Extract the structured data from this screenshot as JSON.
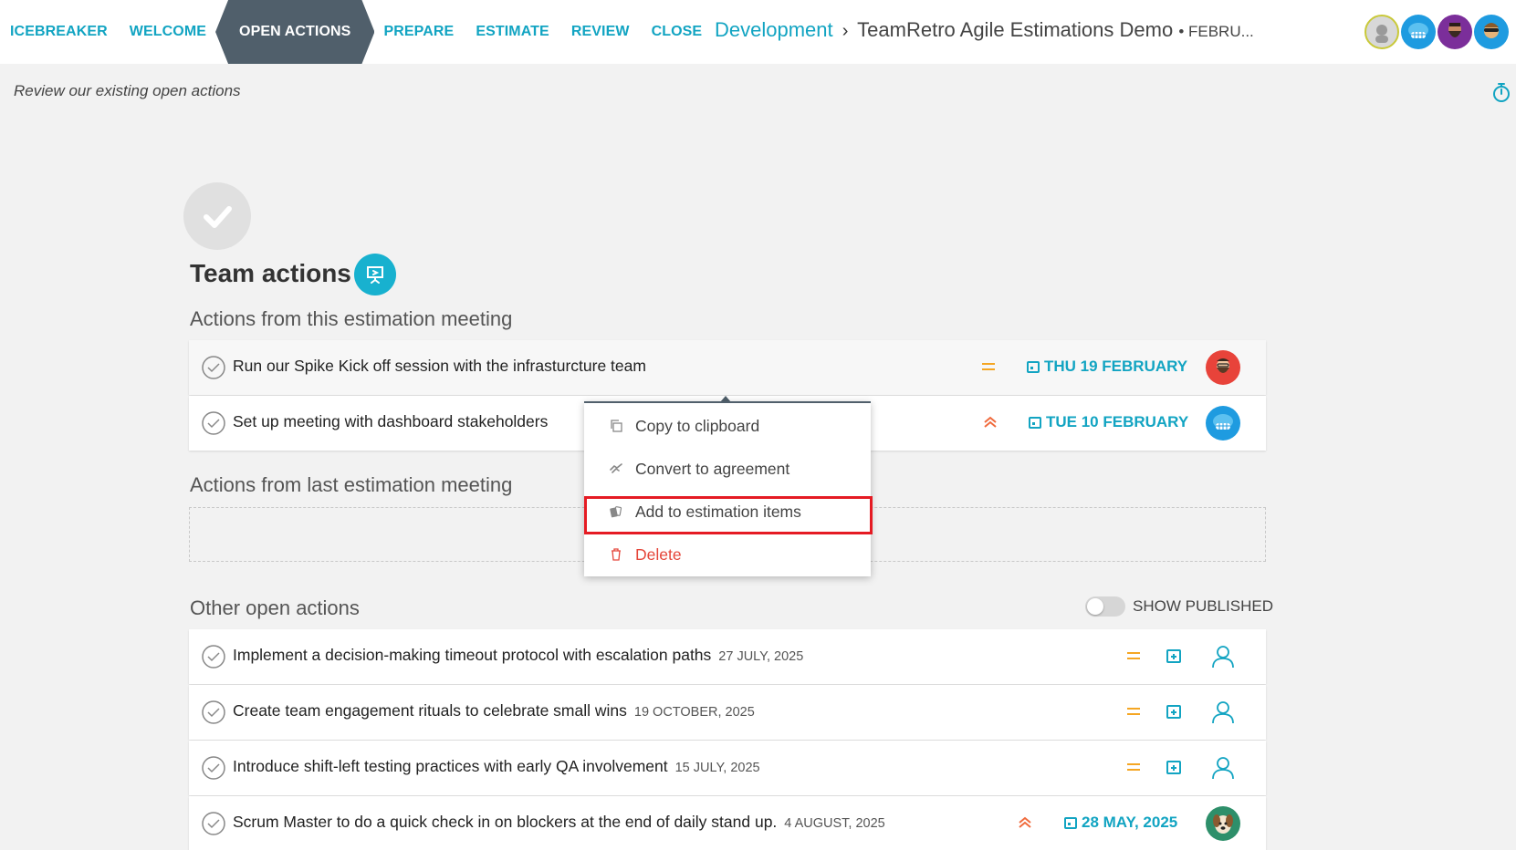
{
  "nav": {
    "items": [
      {
        "label": "ICEBREAKER"
      },
      {
        "label": "WELCOME"
      },
      {
        "label": "OPEN ACTIONS"
      },
      {
        "label": "PREPARE"
      },
      {
        "label": "ESTIMATE"
      },
      {
        "label": "REVIEW"
      },
      {
        "label": "CLOSE"
      }
    ],
    "active_index": 2
  },
  "breadcrumb": {
    "team": "Development",
    "separator": "›",
    "title": "TeamRetro Agile Estimations Demo",
    "date": "• FEBRU..."
  },
  "subtitle": "Review our existing open actions",
  "main": {
    "title": "Team actions",
    "sections": {
      "this_meeting": "Actions from this estimation meeting",
      "last_meeting": "Actions from last estimation meeting",
      "other": "Other open actions"
    },
    "this_meeting_actions": [
      {
        "text": "Run our Spike Kick off session with the infrasturcture team",
        "priority": "medium",
        "due": "THU 19 FEBRUARY"
      },
      {
        "text": "Set up meeting with dashboard stakeholders",
        "priority": "high",
        "due": "TUE 10 FEBRUARY"
      }
    ],
    "show_published_label": "SHOW PUBLISHED",
    "show_published": false,
    "other_actions": [
      {
        "text": "Implement a decision-making timeout protocol with escalation paths",
        "date": "27 JULY, 2025",
        "priority": "medium",
        "due": ""
      },
      {
        "text": "Create team engagement rituals to celebrate small wins",
        "date": "19 OCTOBER, 2025",
        "priority": "medium",
        "due": ""
      },
      {
        "text": "Introduce shift-left testing practices with early QA involvement",
        "date": "15 JULY, 2025",
        "priority": "medium",
        "due": ""
      },
      {
        "text": "Scrum Master to do a quick check in on blockers at the end of daily stand up.",
        "date": "4 AUGUST, 2025",
        "priority": "high",
        "due": "28 MAY, 2025"
      }
    ]
  },
  "context_menu": {
    "items": [
      {
        "label": "Copy to clipboard",
        "icon": "copy-icon"
      },
      {
        "label": "Convert to agreement",
        "icon": "handshake-icon"
      },
      {
        "label": "Add to estimation items",
        "icon": "cards-icon"
      },
      {
        "label": "Delete",
        "icon": "trash-icon"
      }
    ],
    "highlighted_index": 2
  },
  "colors": {
    "accent": "#12a4c2",
    "nav_active_bg": "#505f6b",
    "priority_medium": "#f5a623",
    "priority_high": "#f06a3c",
    "delete": "#e5463a",
    "highlight": "#e51b23"
  }
}
